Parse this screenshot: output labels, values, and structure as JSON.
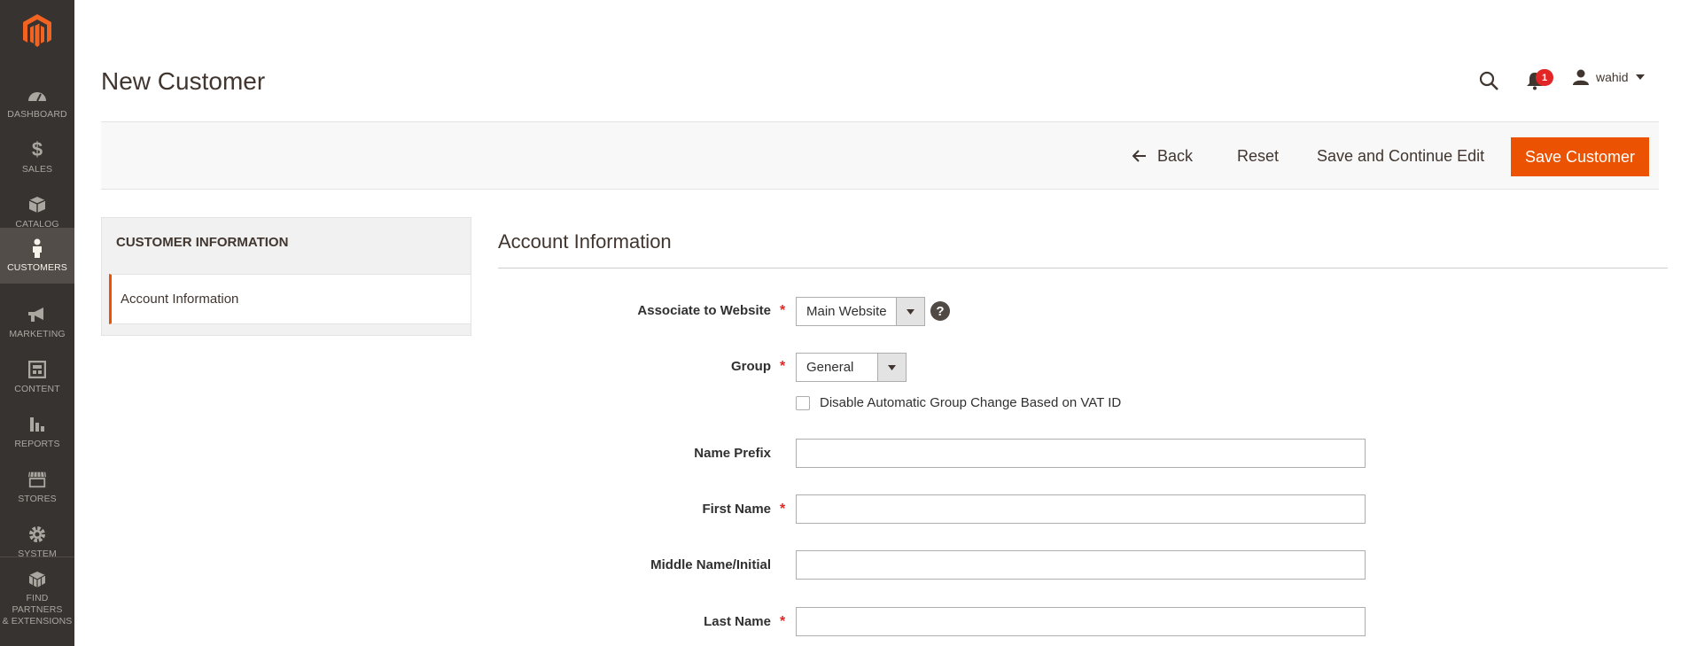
{
  "nav": {
    "items": [
      {
        "label": "DASHBOARD",
        "icon": "dashboard-icon"
      },
      {
        "label": "SALES",
        "icon": "dollar-icon"
      },
      {
        "label": "CATALOG",
        "icon": "box-icon"
      },
      {
        "label": "CUSTOMERS",
        "icon": "person-icon",
        "active": true
      },
      {
        "label": "MARKETING",
        "icon": "megaphone-icon"
      },
      {
        "label": "CONTENT",
        "icon": "layout-icon"
      },
      {
        "label": "REPORTS",
        "icon": "bar-chart-icon"
      },
      {
        "label": "STORES",
        "icon": "storefront-icon"
      },
      {
        "label": "SYSTEM",
        "icon": "gear-icon"
      },
      {
        "label_line1": "FIND PARTNERS",
        "label_line2": "& EXTENSIONS",
        "icon": "cubes-icon"
      }
    ]
  },
  "header": {
    "title": "New Customer",
    "notifications_count": "1",
    "user_name": "wahid"
  },
  "actions": {
    "back": "Back",
    "reset": "Reset",
    "save_continue": "Save and Continue Edit",
    "save": "Save Customer"
  },
  "sidebar": {
    "title": "CUSTOMER INFORMATION",
    "active_tab": "Account Information"
  },
  "form": {
    "section_title": "Account Information",
    "associate_website": {
      "label": "Associate to Website",
      "value": "Main Website"
    },
    "group": {
      "label": "Group",
      "value": "General"
    },
    "disable_group_change": {
      "label": "Disable Automatic Group Change Based on VAT ID",
      "checked": false
    },
    "name_prefix": {
      "label": "Name Prefix",
      "value": ""
    },
    "first_name": {
      "label": "First Name",
      "value": ""
    },
    "middle_name": {
      "label": "Middle Name/Initial",
      "value": ""
    },
    "last_name": {
      "label": "Last Name",
      "value": ""
    }
  },
  "colors": {
    "accent": "#eb5202",
    "nav_bg": "#373330",
    "required": "#e22626"
  }
}
